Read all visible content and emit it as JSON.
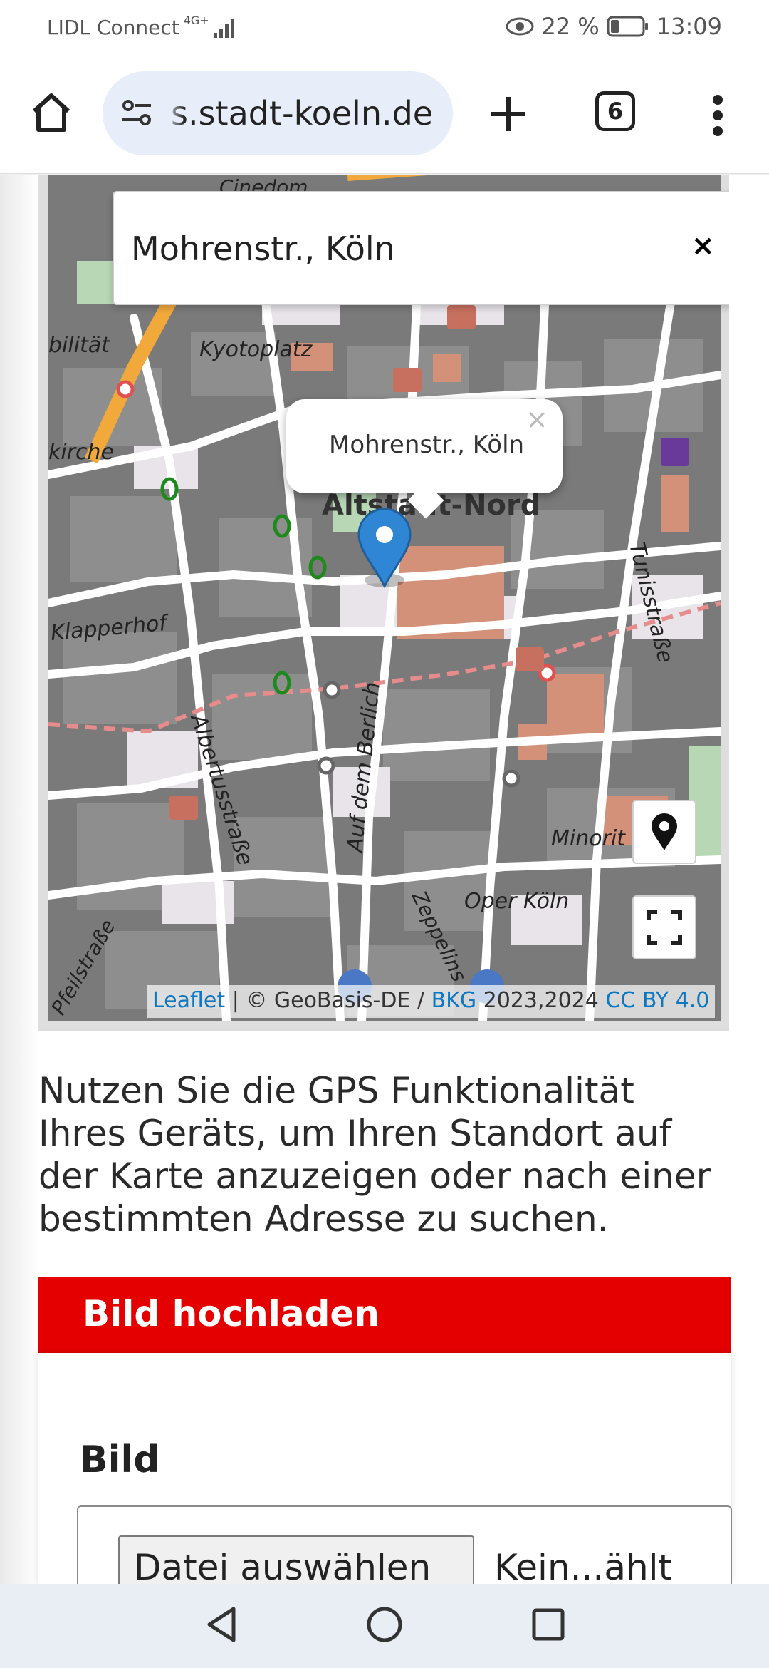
{
  "status_bar": {
    "carrier": "LIDL Connect",
    "network": "4G+",
    "battery": "22 %",
    "time": "13:09"
  },
  "browser": {
    "url": "s.stadt-koeln.de",
    "tab_count": "6"
  },
  "map": {
    "search_value": "Mohrenstr., Köln",
    "popup_text": "Mohrenstr., Köln",
    "labels": {
      "kyotoplatz": "Kyotoplatz",
      "altstadt": "Altstadt-Nord",
      "klapperhof": "Klapperhof",
      "albertus": "Albertusstraße",
      "berlin": "Auf dem Berlich",
      "tunis": "Tunisstraße",
      "oper": "Oper Köln",
      "minorit": "Minorit",
      "kirche": "kirche",
      "bilitat": "bilität",
      "zeppelin": "Zeppelins",
      "pfeil": "Pfeilstraße",
      "cinedom": "Cinedom"
    },
    "attribution": {
      "leaflet": "Leaflet",
      "sep1": " | © GeoBasis-DE / ",
      "bkg": "BKG",
      "years": " 2023,2024 ",
      "license": "CC BY 4.0"
    }
  },
  "description": "Nutzen Sie die GPS Funktionalität Ihres Geräts, um Ihren Standort auf der Karte anzuzeigen oder nach einer bestimmten Adresse zu suchen.",
  "upload": {
    "header": "Bild hochladen",
    "field_label": "Bild",
    "file_button": "Datei auswählen",
    "file_status": "Kein...ählt"
  },
  "colors": {
    "accent_red": "#e50000",
    "link_blue": "#0c78c1",
    "marker_blue": "#2f86d4"
  }
}
